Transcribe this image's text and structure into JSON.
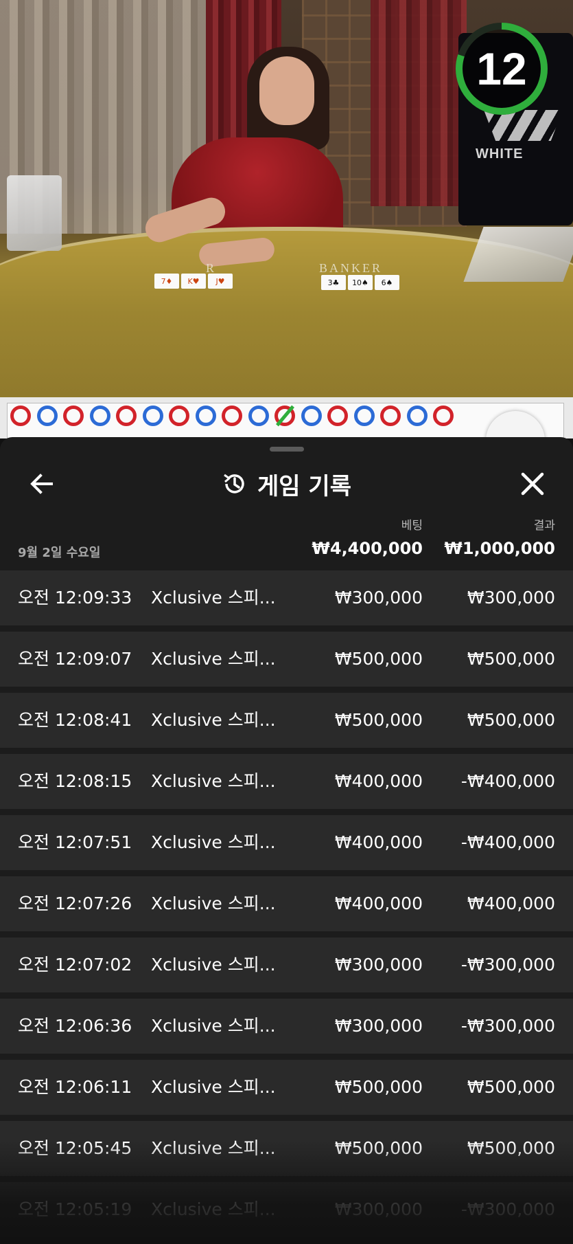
{
  "video": {
    "timer_value": "12",
    "timer_progress": 0.8,
    "timer_color": "#2fae3c",
    "studio_logo_text": "WHITE",
    "table_labels": {
      "player": "R",
      "banker": "BANKER"
    },
    "player_cards": [
      "7♦",
      "K♥",
      "J♥"
    ],
    "banker_cards": [
      "3♣",
      "10♠",
      "6♠"
    ]
  },
  "bead_road": {
    "colors": {
      "banker": "#d2232a",
      "player": "#2c6bd6",
      "tie": "#2fae3c"
    },
    "top_row": [
      "B",
      "P",
      "B",
      "P",
      "B",
      "P",
      "B",
      "P",
      "B",
      "P",
      "B",
      "P",
      "B",
      "P",
      "B",
      "P",
      "B"
    ]
  },
  "panel": {
    "title": "게임 기록",
    "back_icon": "arrow-left-icon",
    "history_icon": "history-icon",
    "close_icon": "close-icon",
    "columns": {
      "bet": "베팅",
      "result": "결과"
    },
    "date": "9월 2일 수요일",
    "total_bet": "₩4,400,000",
    "total_result": "₩1,000,000",
    "rows": [
      {
        "time": "오전 12:09:33",
        "game": "Xclusive 스피...",
        "bet": "₩300,000",
        "result": "₩300,000"
      },
      {
        "time": "오전 12:09:07",
        "game": "Xclusive 스피...",
        "bet": "₩500,000",
        "result": "₩500,000"
      },
      {
        "time": "오전 12:08:41",
        "game": "Xclusive 스피...",
        "bet": "₩500,000",
        "result": "₩500,000"
      },
      {
        "time": "오전 12:08:15",
        "game": "Xclusive 스피...",
        "bet": "₩400,000",
        "result": "-₩400,000"
      },
      {
        "time": "오전 12:07:51",
        "game": "Xclusive 스피...",
        "bet": "₩400,000",
        "result": "-₩400,000"
      },
      {
        "time": "오전 12:07:26",
        "game": "Xclusive 스피...",
        "bet": "₩400,000",
        "result": "₩400,000"
      },
      {
        "time": "오전 12:07:02",
        "game": "Xclusive 스피...",
        "bet": "₩300,000",
        "result": "-₩300,000"
      },
      {
        "time": "오전 12:06:36",
        "game": "Xclusive 스피...",
        "bet": "₩300,000",
        "result": "-₩300,000"
      },
      {
        "time": "오전 12:06:11",
        "game": "Xclusive 스피...",
        "bet": "₩500,000",
        "result": "₩500,000"
      },
      {
        "time": "오전 12:05:45",
        "game": "Xclusive 스피...",
        "bet": "₩500,000",
        "result": "₩500,000"
      },
      {
        "time": "오전 12:05:19",
        "game": "Xclusive 스피...",
        "bet": "₩300,000",
        "result": "-₩300,000"
      }
    ]
  }
}
